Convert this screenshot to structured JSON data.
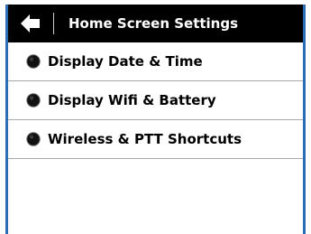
{
  "header": {
    "title": "Home Screen Settings",
    "back_icon": "arrow-left-icon"
  },
  "items": [
    {
      "label": "Display Date & Time",
      "icon": "radio-filled-icon"
    },
    {
      "label": "Display Wifi & Battery",
      "icon": "radio-filled-icon"
    },
    {
      "label": "Wireless & PTT Shortcuts",
      "icon": "radio-filled-icon"
    }
  ],
  "colors": {
    "header_background": "#000000",
    "header_text": "#ffffff",
    "frame_border": "#2a6db5",
    "row_divider": "#a9a9a9"
  }
}
